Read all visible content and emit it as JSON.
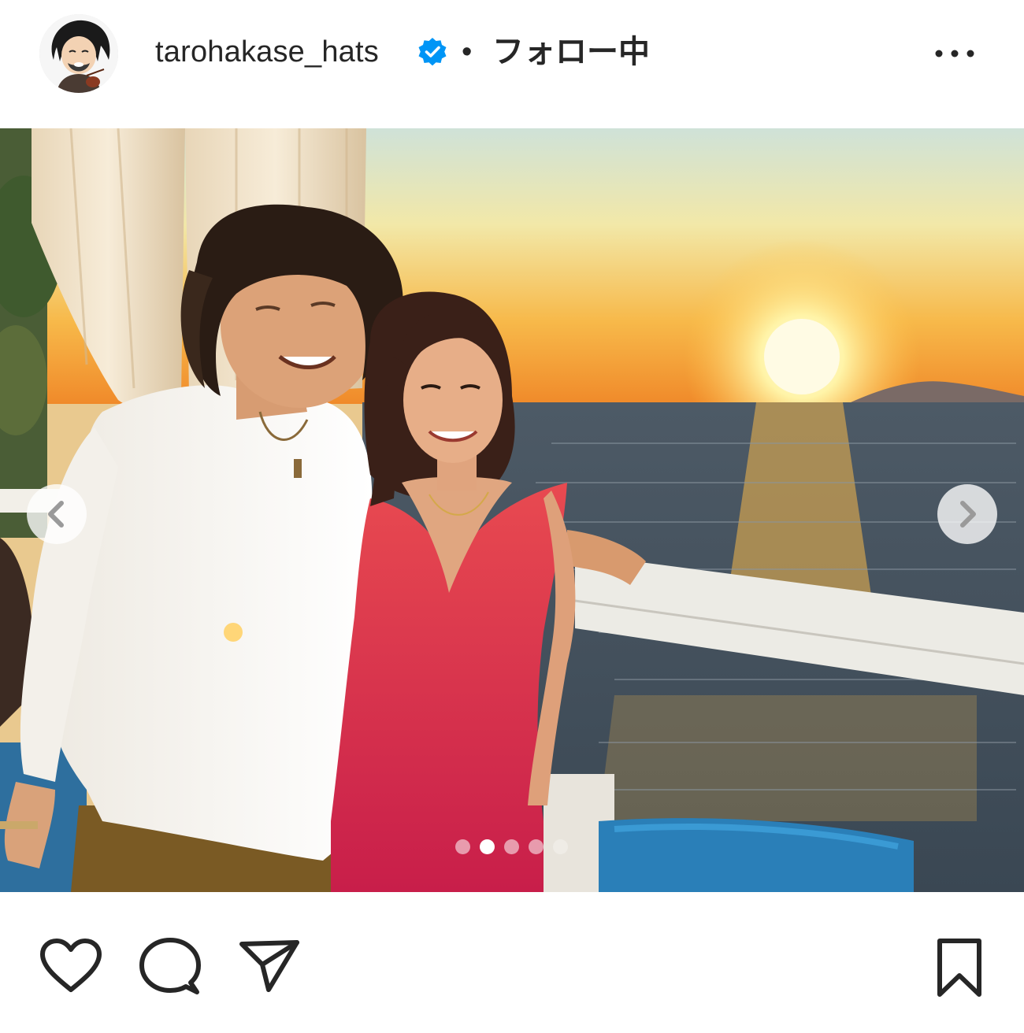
{
  "post": {
    "username": "tarohakase_hats",
    "separator": "•",
    "follow_status": "フォロー中",
    "verified": true,
    "header_icons": {
      "verified": "verified-badge-icon",
      "more": "more-options-icon"
    },
    "avatar": "profile-avatar-illustration"
  },
  "media": {
    "description_icon": "photo",
    "carousel": {
      "total": 5,
      "current_index": 1
    },
    "nav": {
      "prev_icon": "chevron-left-icon",
      "next_icon": "chevron-right-icon"
    }
  },
  "actions": {
    "like_icon": "heart-icon",
    "comment_icon": "comment-bubble-icon",
    "share_icon": "paper-plane-icon",
    "save_icon": "bookmark-icon"
  },
  "colors": {
    "verified_blue": "#0095f6",
    "text": "#262626",
    "icon": "#262626"
  }
}
